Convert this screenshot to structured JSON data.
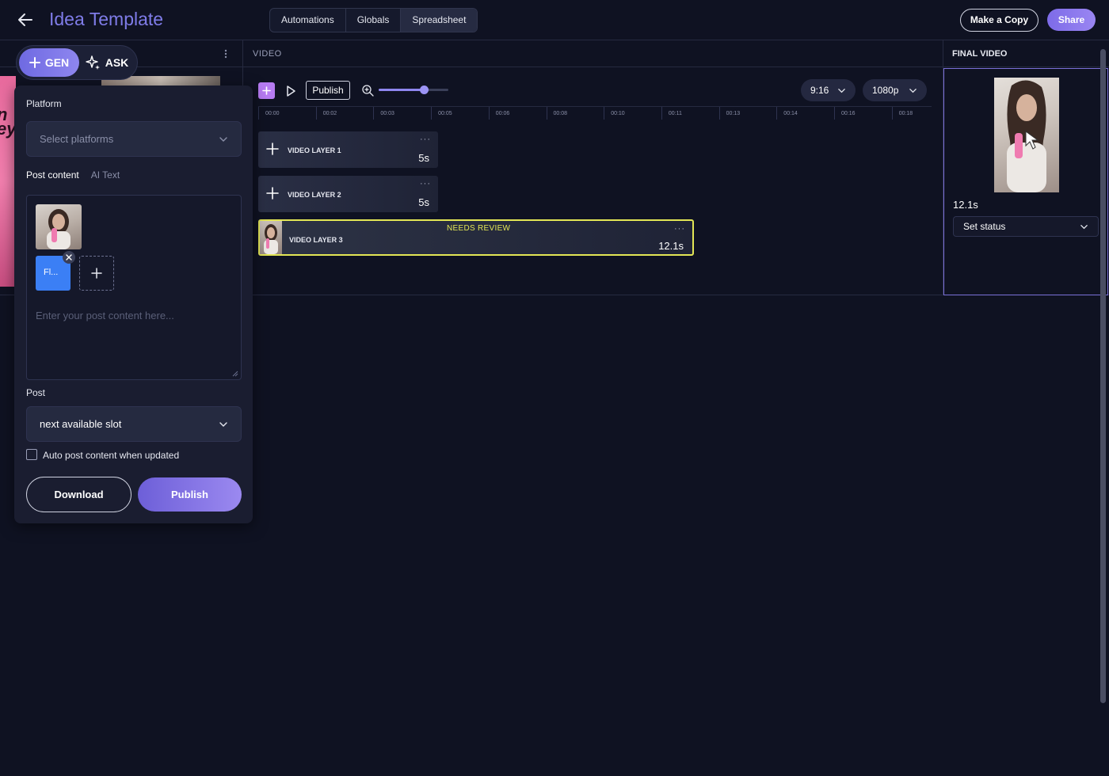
{
  "header": {
    "title": "Idea Template",
    "tabs": [
      {
        "label": "Automations"
      },
      {
        "label": "Globals"
      },
      {
        "label": "Spreadsheet"
      }
    ],
    "make_copy_label": "Make a Copy",
    "share_label": "Share"
  },
  "left": {
    "gen_label": "GEN",
    "ask_label": "ASK"
  },
  "panel": {
    "platform_label": "Platform",
    "platform_placeholder": "Select platforms",
    "post_content_tab": "Post content",
    "ai_text_tab": "AI Text",
    "file_label": "Fl...",
    "post_content_placeholder": "Enter your post content here...",
    "post_label": "Post",
    "post_slot_value": "next available slot",
    "auto_post_label": "Auto post content when updated",
    "download_label": "Download",
    "publish_label": "Publish"
  },
  "video": {
    "section_label": "VIDEO",
    "publish_label": "Publish",
    "zoom_level": 0.65,
    "aspect_ratio": "9:16",
    "resolution": "1080p",
    "ruler_ticks": [
      "00:00",
      "00:02",
      "00:03",
      "00:05",
      "00:06",
      "00:08",
      "00:10",
      "00:11",
      "00:13",
      "00:14",
      "00:16",
      "00:18"
    ],
    "layers": [
      {
        "name": "VIDEO LAYER 1",
        "duration": "5s",
        "menu": "···"
      },
      {
        "name": "VIDEO LAYER 2",
        "duration": "5s",
        "menu": "···"
      },
      {
        "name": "VIDEO LAYER 3",
        "duration": "12.1s",
        "menu": "···",
        "badge": "NEEDS REVIEW"
      }
    ]
  },
  "final": {
    "section_label": "FINAL VIDEO",
    "duration": "12.1s",
    "status_placeholder": "Set status"
  },
  "colors": {
    "background": "#0f1222",
    "accent": "#7d6be8",
    "review": "#e3e655",
    "file_tile": "#3b7ff5"
  }
}
